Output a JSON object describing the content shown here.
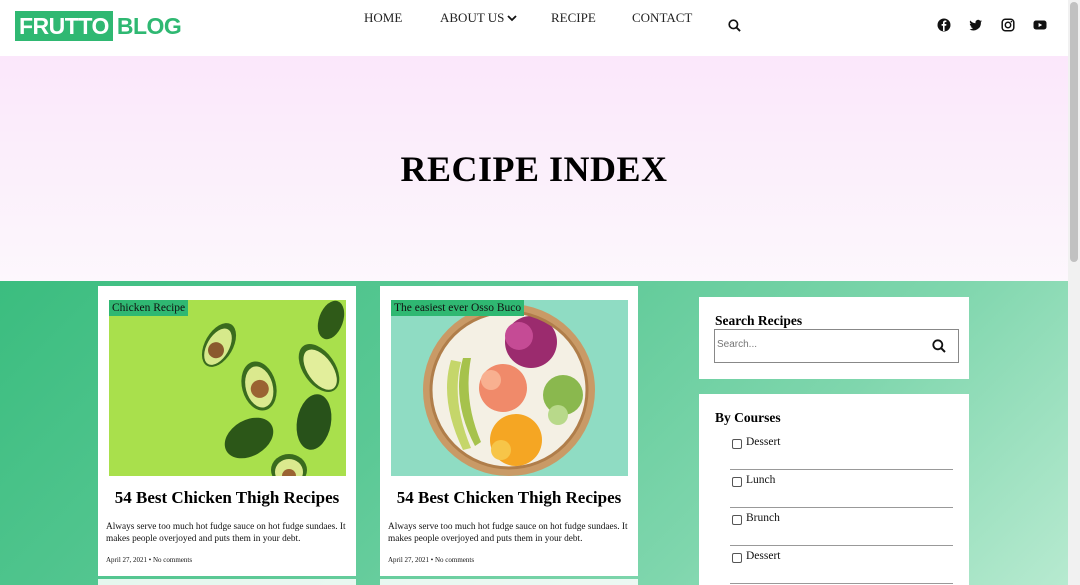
{
  "logo": {
    "part1": "FRUTTO",
    "part2": "BLOG"
  },
  "nav": {
    "home": "HOME",
    "about": "ABOUT US",
    "recipe": "RECIPE",
    "contact": "CONTACT"
  },
  "social": [
    "facebook-icon",
    "twitter-icon",
    "instagram-icon",
    "youtube-icon"
  ],
  "hero": {
    "title": "RECIPE INDEX"
  },
  "cards": [
    {
      "badge": "Chicken Recipe",
      "title": "54 Best Chicken Thigh Recipes",
      "text": "Always serve too much hot fudge sauce on hot fudge sundaes. It makes people overjoyed and puts them in your debt.",
      "date": "April 27, 2021",
      "comments": "No comments"
    },
    {
      "badge": "The easiest ever Osso Buco",
      "title": "54 Best Chicken Thigh Recipes",
      "text": "Always serve too much hot fudge sauce on hot fudge sundaes. It makes people overjoyed and puts them in your debt.",
      "date": "April 27, 2021",
      "comments": "No comments"
    }
  ],
  "sidebar": {
    "search": {
      "title": "Search Recipes",
      "placeholder": "Search..."
    },
    "courses": {
      "title": "By Courses",
      "items": [
        "Dessert",
        "Lunch",
        "Brunch",
        "Dessert"
      ]
    }
  },
  "colors": {
    "accent": "#2fb872",
    "hero_bg": "#fbe7fb"
  }
}
